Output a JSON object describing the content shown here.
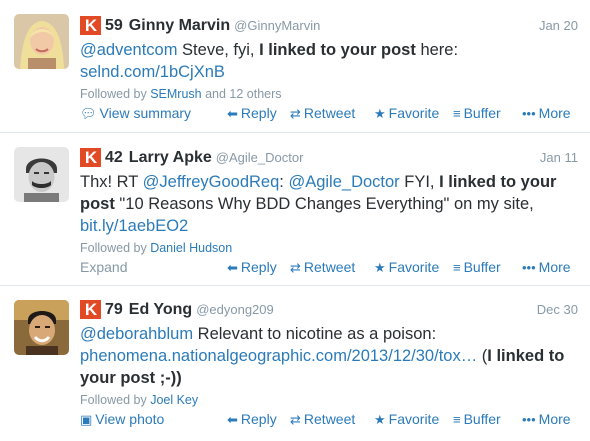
{
  "tweets": [
    {
      "klout_badge": "K",
      "score": "59",
      "name": "Ginny Marvin",
      "handle": "@GinnyMarvin",
      "time": "Jan 20",
      "text": {
        "mention": "@adventcom",
        "p1": " Steve, fyi, ",
        "bold1": "I linked to your post",
        "p2": " here:",
        "url": "selnd.com/1bCjXnB"
      },
      "followed_prefix": "Followed by ",
      "followed_who": "SEMrush",
      "followed_suffix": " and 12 others",
      "secondary_action": "View summary"
    },
    {
      "klout_badge": "K",
      "score": "42",
      "name": "Larry Apke",
      "handle": "@Agile_Doctor",
      "time": "Jan 11",
      "text": {
        "p0": "Thx! RT ",
        "mention1": "@JeffreyGoodReq",
        "p1": ": ",
        "mention2": "@Agile_Doctor",
        "p2": " FYI, ",
        "bold1": "I linked to your post",
        "p3": " \"10 Reasons Why BDD Changes Everything\" on my site,",
        "url": "bit.ly/1aebEO2"
      },
      "followed_prefix": "Followed by ",
      "followed_who": "Daniel Hudson",
      "followed_suffix": "",
      "secondary_action": "Expand"
    },
    {
      "klout_badge": "K",
      "score": "79",
      "name": "Ed Yong",
      "handle": "@edyong209",
      "time": "Dec 30",
      "text": {
        "mention": "@deborahblum",
        "p1": " Relevant to nicotine as a poison:",
        "url": "phenomena.nationalgeographic.com/2013/12/30/tox…",
        "p2": " (",
        "bold1": "I linked to your post",
        "p3": " ;-))"
      },
      "followed_prefix": "Followed by ",
      "followed_who": "Joel Key",
      "followed_suffix": "",
      "secondary_action": "View photo"
    }
  ],
  "actions": {
    "reply": "Reply",
    "retweet": "Retweet",
    "favorite": "Favorite",
    "buffer": "Buffer",
    "more": "More"
  },
  "icons": {
    "reply": "reply-arrow-icon",
    "retweet": "retweet-icon",
    "favorite": "star-icon",
    "buffer": "buffer-stack-icon",
    "more": "dots-icon",
    "summary": "summary-doc-icon",
    "photo": "photo-icon"
  },
  "colors": {
    "link": "#2b7bb9",
    "muted": "#8899a6",
    "klout": "#e24a25"
  }
}
